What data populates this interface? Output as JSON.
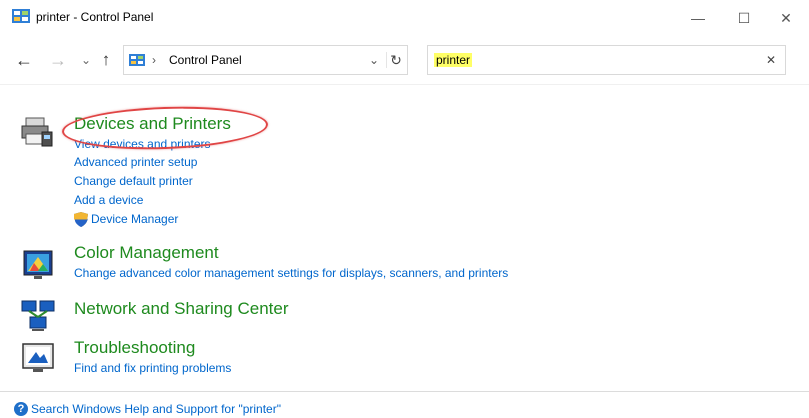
{
  "window": {
    "title": "printer - Control Panel",
    "minimize_glyph": "—",
    "maximize_glyph": "☐",
    "close_glyph": "✕"
  },
  "nav": {
    "back_glyph": "←",
    "forward_glyph": "→",
    "recent_glyph": "⌄",
    "up_glyph": "↑",
    "address_separator": "›",
    "address_text": "Control Panel",
    "address_dropdown_glyph": "⌄",
    "refresh_glyph": "↻",
    "search_value": "printer",
    "search_clear_glyph": "✕"
  },
  "results": [
    {
      "title": "Devices and Printers",
      "icon": "printer-icon",
      "links": [
        "View devices and printers",
        "Advanced printer setup",
        "Change default printer",
        "Add a device",
        "Device Manager"
      ]
    },
    {
      "title": "Color Management",
      "icon": "color-management-icon",
      "links": [
        "Change advanced color management settings for displays, scanners, and printers"
      ]
    },
    {
      "title": "Network and Sharing Center",
      "icon": "network-icon",
      "links": []
    },
    {
      "title": "Troubleshooting",
      "icon": "troubleshooting-icon",
      "links": [
        "Find and fix printing problems"
      ]
    }
  ],
  "footer": {
    "help_glyph": "?",
    "help_text": "Search Windows Help and Support for \"printer\""
  },
  "colors": {
    "title_green": "#1e8a1e",
    "link_blue": "#0066cc",
    "highlight": "#ffff66",
    "callout_red": "#e04545"
  }
}
